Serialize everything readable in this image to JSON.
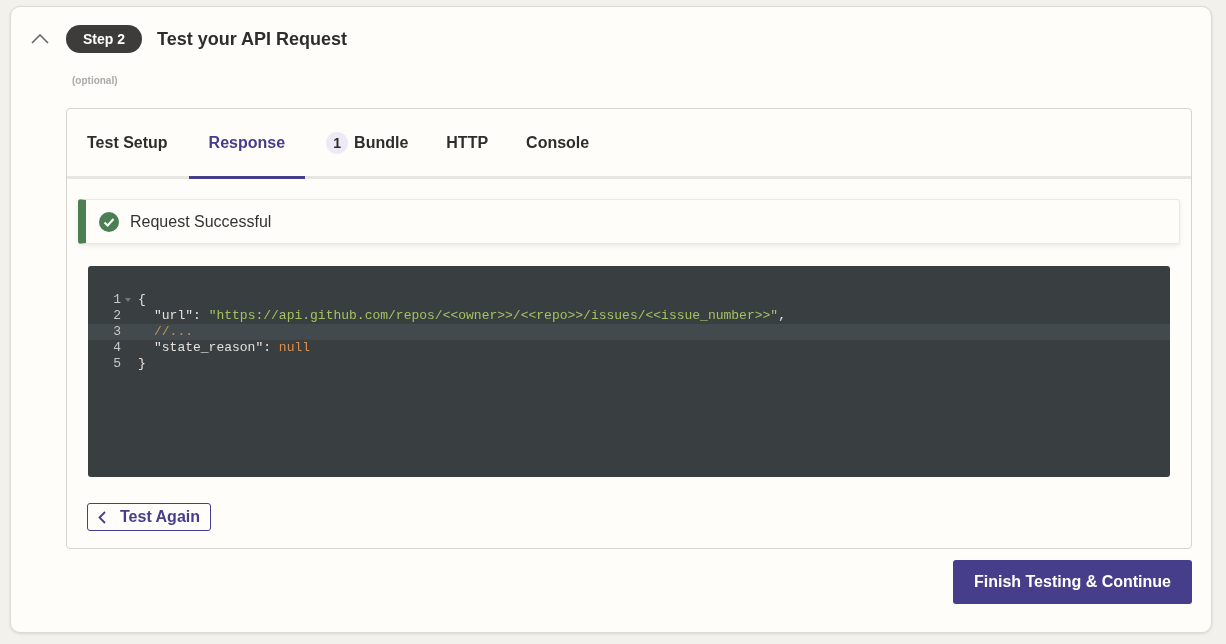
{
  "step": {
    "badge": "Step 2",
    "title": "Test your API Request",
    "expanded": true,
    "note": "(optional)"
  },
  "tabs": [
    {
      "label": "Test Setup",
      "selected": false
    },
    {
      "label": "Response",
      "selected": true
    },
    {
      "label": "Bundle",
      "selected": false,
      "count": "1"
    },
    {
      "label": "HTTP",
      "selected": false
    },
    {
      "label": "Console",
      "selected": false
    }
  ],
  "alert": {
    "kind": "success",
    "message": "Request Successful"
  },
  "code": {
    "lines": [
      {
        "number": "1",
        "active": false,
        "foldable": true,
        "indented": false,
        "tokens": [
          {
            "kind": "punct",
            "text": "{"
          }
        ]
      },
      {
        "number": "2",
        "active": false,
        "foldable": false,
        "indented": true,
        "tokens": [
          {
            "kind": "key",
            "text": "\"url\""
          },
          {
            "kind": "punct",
            "text": ": "
          },
          {
            "kind": "string",
            "text": "\"https://api.github.com/repos/<<owner>>/<<repo>>/issues/<<issue_number>>\""
          },
          {
            "kind": "punct",
            "text": ","
          }
        ]
      },
      {
        "number": "3",
        "active": true,
        "foldable": false,
        "indented": true,
        "tokens": [
          {
            "kind": "comment",
            "text": "//..."
          }
        ]
      },
      {
        "number": "4",
        "active": false,
        "foldable": false,
        "indented": true,
        "tokens": [
          {
            "kind": "key",
            "text": "\"state_reason\""
          },
          {
            "kind": "punct",
            "text": ": "
          },
          {
            "kind": "null",
            "text": "null"
          }
        ]
      },
      {
        "number": "5",
        "active": false,
        "foldable": false,
        "indented": false,
        "tokens": [
          {
            "kind": "punct",
            "text": "}"
          }
        ]
      }
    ]
  },
  "buttons": {
    "back": "Test Again",
    "primary": "Finish Testing & Continue"
  }
}
